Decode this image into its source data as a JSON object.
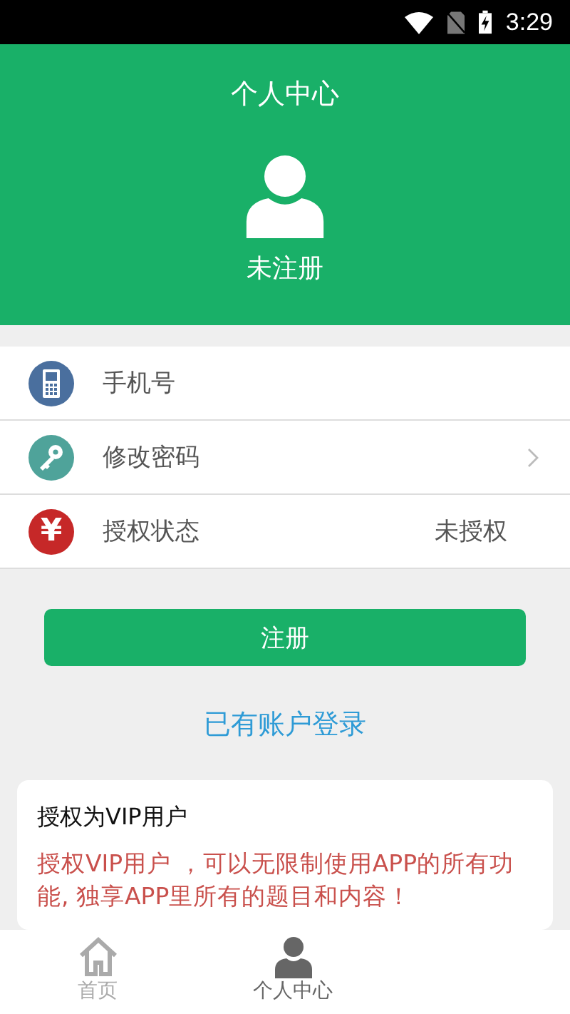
{
  "status_bar": {
    "time": "3:29"
  },
  "header": {
    "title": "个人中心",
    "user_status": "未注册"
  },
  "menu": [
    {
      "kind": "phone",
      "label": "手机号",
      "arrow": false
    },
    {
      "kind": "key",
      "label": "修改密码",
      "arrow": true
    },
    {
      "kind": "yuan",
      "icon_text": "¥",
      "label": "授权状态",
      "value": "未授权",
      "arrow": false
    }
  ],
  "register_button": "注册",
  "login_link": "已有账户登录",
  "vip_card": {
    "title": "授权为VIP用户",
    "description": "授权VIP用户 ，可以无限制使用APP的所有功能, 独享APP里所有的题目和内容！"
  },
  "bottom_nav": [
    {
      "kind": "home",
      "label": "首页",
      "selected": false
    },
    {
      "kind": "person",
      "label": "个人中心",
      "selected": true
    }
  ]
}
